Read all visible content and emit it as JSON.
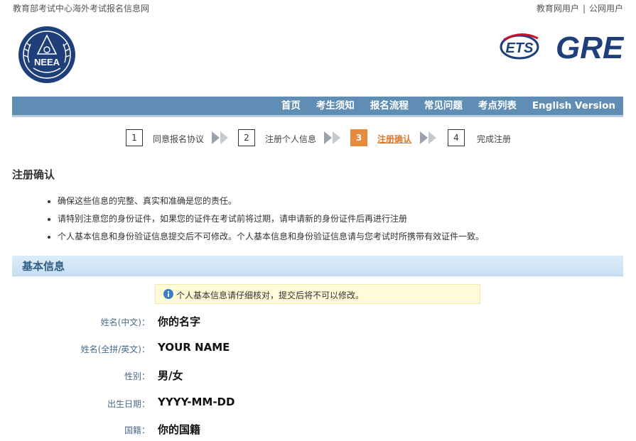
{
  "header": {
    "site_name": "教育部考试中心海外考试报名信息网",
    "user_links": [
      "教育网用户",
      "公网用户"
    ],
    "separator": "|",
    "logo_text": "NEEA",
    "ets_text": "ETS",
    "gre_text": "GRE"
  },
  "nav": {
    "items": [
      "首页",
      "考生须知",
      "报名流程",
      "常见问题",
      "考点列表",
      "English Version"
    ]
  },
  "steps": [
    {
      "num": "1",
      "label": "同意报名协议",
      "active": false
    },
    {
      "num": "2",
      "label": "注册个人信息",
      "active": false
    },
    {
      "num": "3",
      "label": "注册确认",
      "active": true
    },
    {
      "num": "4",
      "label": "完成注册",
      "active": false
    }
  ],
  "page_title": "注册确认",
  "notices": [
    "确保这些信息的完整、真实和准确是您的责任。",
    "请特别注意您的身份证件，如果您的证件在考试前将过期，请申请新的身份证件后再进行注册",
    "个人基本信息和身份验证信息提交后不可修改。个人基本信息和身份验证信息请与您考试时所携带有效证件一致。"
  ],
  "basic_info": {
    "title": "基本信息",
    "hint": "个人基本信息请仔细核对，提交后将不可以修改。",
    "fields": [
      {
        "label": "姓名(中文)：",
        "value": "你的名字"
      },
      {
        "label": "姓名(全拼/英文)：",
        "value": "YOUR NAME"
      },
      {
        "label": "性别：",
        "value": "男/女"
      },
      {
        "label": "出生日期：",
        "value": "YYYY-MM-DD"
      },
      {
        "label": "国籍：",
        "value": "你的国籍"
      }
    ]
  },
  "colors": {
    "nav_bg": "#5f8db3",
    "step_active": "#e88a3c",
    "brand_blue": "#1f3f7a",
    "hint_bg": "#fffad8"
  }
}
